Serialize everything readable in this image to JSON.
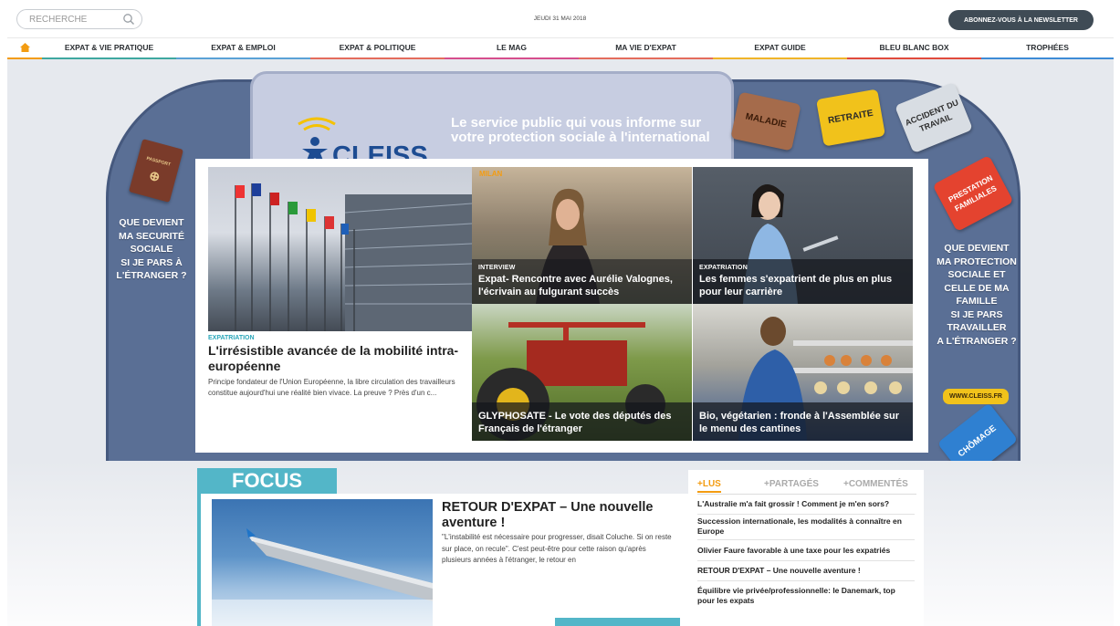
{
  "header": {
    "search_placeholder": "RECHERCHE",
    "date": "JEUDI 31 MAI 2018",
    "newsletter_label": "ABONNEZ-VOUS À LA NEWSLETTER"
  },
  "nav": {
    "items": [
      {
        "label": "EXPAT & VIE PRATIQUE",
        "color": "#3fa8a0"
      },
      {
        "label": "EXPAT & EMPLOI",
        "color": "#5aa1d6"
      },
      {
        "label": "EXPAT & POLITIQUE",
        "color": "#e46c5c"
      },
      {
        "label": "LE MAG",
        "color": "#d64e8c"
      },
      {
        "label": "MA VIE D'EXPAT",
        "color": "#e46c5c"
      },
      {
        "label": "EXPAT GUIDE",
        "color": "#f0b429"
      },
      {
        "label": "BLEU BLANC BOX",
        "color": "#e04a3c"
      },
      {
        "label": "TROPHÉES",
        "color": "#3d8bd6"
      }
    ]
  },
  "banner": {
    "logo_text": "CLEISS",
    "tagline_line1": "Le service public qui vous informe sur",
    "tagline_line2": "votre protection sociale à l'international",
    "left_text": [
      "QUE DEVIENT",
      "MA SECURITÉ",
      "SOCIALE",
      "SI JE PARS À",
      "L'ÉTRANGER ?"
    ],
    "right_text": [
      "QUE DEVIENT",
      "MA PROTECTION",
      "SOCIALE ET",
      "CELLE DE MA",
      "FAMILLE",
      "SI JE PARS",
      "TRAVAILLER",
      "A L'ÉTRANGER ?"
    ],
    "link": "WWW.CLEISS.FR",
    "cases": {
      "maladie": "MALADIE",
      "retraite": "RETRAITE",
      "accident": "ACCIDENT DU TRAVAIL",
      "prestation": "PRESTATION FAMILIALES",
      "chomage": "CHÔMAGE",
      "passport": "PASSPORT"
    }
  },
  "lead": {
    "kicker": "EXPATRIATION",
    "title": "L'irrésistible avancée de la mobilité intra-européenne",
    "desc": "Principe fondateur de l'Union Européenne, la libre circulation des travailleurs constitue aujourd'hui une réalité bien vivace. La preuve ? Près d'un c..."
  },
  "tiles": [
    {
      "tag": "MILAN",
      "kicker": "INTERVIEW",
      "title": "Expat- Rencontre avec Aurélie Valognes, l'écrivain au fulgurant succès"
    },
    {
      "kicker": "EXPATRIATION",
      "title": "Les femmes s'expatrient de plus en plus pour leur carrière"
    },
    {
      "kicker": "",
      "title": "GLYPHOSATE - Le vote des députés des Français de l'étranger"
    },
    {
      "kicker": "",
      "title": "Bio, végétarien : fronde à l'Assemblée sur le menu des cantines"
    }
  ],
  "focus": {
    "tab": "FOCUS",
    "title": "RETOUR D'EXPAT – Une nouvelle aventure !",
    "desc": "\"L'instabilité est nécessaire pour progresser, disait Coluche. Si on reste sur place, on recule\". C'est peut-être pour cette raison qu'après plusieurs années à l'étranger, le retour en"
  },
  "ranking": {
    "tabs": [
      "+LUS",
      "+PARTAGÉS",
      "+COMMENTÉS"
    ],
    "items": [
      "L'Australie m'a fait grossir ! Comment je m'en sors?",
      "Succession internationale, les modalités à connaître en Europe",
      "Olivier Faure favorable à une taxe pour les expatriés",
      "RETOUR D'EXPAT – Une nouvelle aventure !",
      "Équilibre vie privée/professionnelle: le Danemark, top pour les expats"
    ]
  }
}
